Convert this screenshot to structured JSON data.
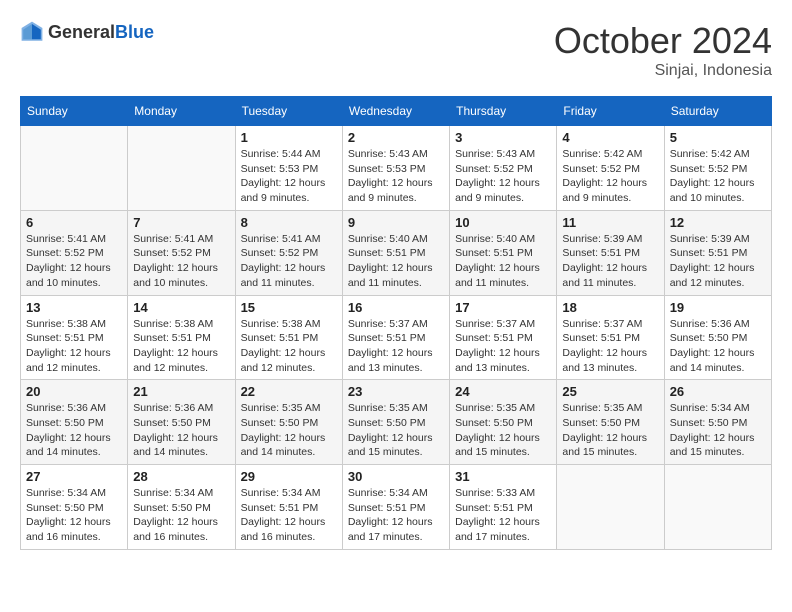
{
  "header": {
    "logo_general": "General",
    "logo_blue": "Blue",
    "month_title": "October 2024",
    "location": "Sinjai, Indonesia"
  },
  "days_of_week": [
    "Sunday",
    "Monday",
    "Tuesday",
    "Wednesday",
    "Thursday",
    "Friday",
    "Saturday"
  ],
  "weeks": [
    [
      {
        "day": "",
        "sunrise": "",
        "sunset": "",
        "daylight": ""
      },
      {
        "day": "",
        "sunrise": "",
        "sunset": "",
        "daylight": ""
      },
      {
        "day": "1",
        "sunrise": "Sunrise: 5:44 AM",
        "sunset": "Sunset: 5:53 PM",
        "daylight": "Daylight: 12 hours and 9 minutes."
      },
      {
        "day": "2",
        "sunrise": "Sunrise: 5:43 AM",
        "sunset": "Sunset: 5:53 PM",
        "daylight": "Daylight: 12 hours and 9 minutes."
      },
      {
        "day": "3",
        "sunrise": "Sunrise: 5:43 AM",
        "sunset": "Sunset: 5:52 PM",
        "daylight": "Daylight: 12 hours and 9 minutes."
      },
      {
        "day": "4",
        "sunrise": "Sunrise: 5:42 AM",
        "sunset": "Sunset: 5:52 PM",
        "daylight": "Daylight: 12 hours and 9 minutes."
      },
      {
        "day": "5",
        "sunrise": "Sunrise: 5:42 AM",
        "sunset": "Sunset: 5:52 PM",
        "daylight": "Daylight: 12 hours and 10 minutes."
      }
    ],
    [
      {
        "day": "6",
        "sunrise": "Sunrise: 5:41 AM",
        "sunset": "Sunset: 5:52 PM",
        "daylight": "Daylight: 12 hours and 10 minutes."
      },
      {
        "day": "7",
        "sunrise": "Sunrise: 5:41 AM",
        "sunset": "Sunset: 5:52 PM",
        "daylight": "Daylight: 12 hours and 10 minutes."
      },
      {
        "day": "8",
        "sunrise": "Sunrise: 5:41 AM",
        "sunset": "Sunset: 5:52 PM",
        "daylight": "Daylight: 12 hours and 11 minutes."
      },
      {
        "day": "9",
        "sunrise": "Sunrise: 5:40 AM",
        "sunset": "Sunset: 5:51 PM",
        "daylight": "Daylight: 12 hours and 11 minutes."
      },
      {
        "day": "10",
        "sunrise": "Sunrise: 5:40 AM",
        "sunset": "Sunset: 5:51 PM",
        "daylight": "Daylight: 12 hours and 11 minutes."
      },
      {
        "day": "11",
        "sunrise": "Sunrise: 5:39 AM",
        "sunset": "Sunset: 5:51 PM",
        "daylight": "Daylight: 12 hours and 11 minutes."
      },
      {
        "day": "12",
        "sunrise": "Sunrise: 5:39 AM",
        "sunset": "Sunset: 5:51 PM",
        "daylight": "Daylight: 12 hours and 12 minutes."
      }
    ],
    [
      {
        "day": "13",
        "sunrise": "Sunrise: 5:38 AM",
        "sunset": "Sunset: 5:51 PM",
        "daylight": "Daylight: 12 hours and 12 minutes."
      },
      {
        "day": "14",
        "sunrise": "Sunrise: 5:38 AM",
        "sunset": "Sunset: 5:51 PM",
        "daylight": "Daylight: 12 hours and 12 minutes."
      },
      {
        "day": "15",
        "sunrise": "Sunrise: 5:38 AM",
        "sunset": "Sunset: 5:51 PM",
        "daylight": "Daylight: 12 hours and 12 minutes."
      },
      {
        "day": "16",
        "sunrise": "Sunrise: 5:37 AM",
        "sunset": "Sunset: 5:51 PM",
        "daylight": "Daylight: 12 hours and 13 minutes."
      },
      {
        "day": "17",
        "sunrise": "Sunrise: 5:37 AM",
        "sunset": "Sunset: 5:51 PM",
        "daylight": "Daylight: 12 hours and 13 minutes."
      },
      {
        "day": "18",
        "sunrise": "Sunrise: 5:37 AM",
        "sunset": "Sunset: 5:51 PM",
        "daylight": "Daylight: 12 hours and 13 minutes."
      },
      {
        "day": "19",
        "sunrise": "Sunrise: 5:36 AM",
        "sunset": "Sunset: 5:50 PM",
        "daylight": "Daylight: 12 hours and 14 minutes."
      }
    ],
    [
      {
        "day": "20",
        "sunrise": "Sunrise: 5:36 AM",
        "sunset": "Sunset: 5:50 PM",
        "daylight": "Daylight: 12 hours and 14 minutes."
      },
      {
        "day": "21",
        "sunrise": "Sunrise: 5:36 AM",
        "sunset": "Sunset: 5:50 PM",
        "daylight": "Daylight: 12 hours and 14 minutes."
      },
      {
        "day": "22",
        "sunrise": "Sunrise: 5:35 AM",
        "sunset": "Sunset: 5:50 PM",
        "daylight": "Daylight: 12 hours and 14 minutes."
      },
      {
        "day": "23",
        "sunrise": "Sunrise: 5:35 AM",
        "sunset": "Sunset: 5:50 PM",
        "daylight": "Daylight: 12 hours and 15 minutes."
      },
      {
        "day": "24",
        "sunrise": "Sunrise: 5:35 AM",
        "sunset": "Sunset: 5:50 PM",
        "daylight": "Daylight: 12 hours and 15 minutes."
      },
      {
        "day": "25",
        "sunrise": "Sunrise: 5:35 AM",
        "sunset": "Sunset: 5:50 PM",
        "daylight": "Daylight: 12 hours and 15 minutes."
      },
      {
        "day": "26",
        "sunrise": "Sunrise: 5:34 AM",
        "sunset": "Sunset: 5:50 PM",
        "daylight": "Daylight: 12 hours and 15 minutes."
      }
    ],
    [
      {
        "day": "27",
        "sunrise": "Sunrise: 5:34 AM",
        "sunset": "Sunset: 5:50 PM",
        "daylight": "Daylight: 12 hours and 16 minutes."
      },
      {
        "day": "28",
        "sunrise": "Sunrise: 5:34 AM",
        "sunset": "Sunset: 5:50 PM",
        "daylight": "Daylight: 12 hours and 16 minutes."
      },
      {
        "day": "29",
        "sunrise": "Sunrise: 5:34 AM",
        "sunset": "Sunset: 5:51 PM",
        "daylight": "Daylight: 12 hours and 16 minutes."
      },
      {
        "day": "30",
        "sunrise": "Sunrise: 5:34 AM",
        "sunset": "Sunset: 5:51 PM",
        "daylight": "Daylight: 12 hours and 17 minutes."
      },
      {
        "day": "31",
        "sunrise": "Sunrise: 5:33 AM",
        "sunset": "Sunset: 5:51 PM",
        "daylight": "Daylight: 12 hours and 17 minutes."
      },
      {
        "day": "",
        "sunrise": "",
        "sunset": "",
        "daylight": ""
      },
      {
        "day": "",
        "sunrise": "",
        "sunset": "",
        "daylight": ""
      }
    ]
  ]
}
